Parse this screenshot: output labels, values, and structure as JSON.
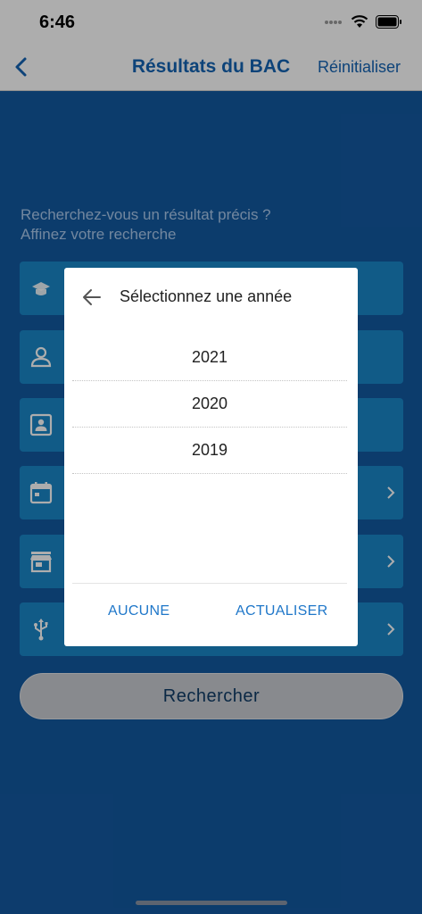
{
  "status": {
    "time": "6:46"
  },
  "nav": {
    "title": "Résultats du BAC",
    "reset_label": "Réinitialiser"
  },
  "form": {
    "intro_line1": "Recherchez-vous un résultat précis ?",
    "intro_line2": "Affinez votre recherche",
    "fields": [
      {
        "icon": "graduate-icon"
      },
      {
        "icon": "person-icon"
      },
      {
        "icon": "id-card-icon"
      },
      {
        "icon": "calendar-icon"
      },
      {
        "icon": "store-icon"
      },
      {
        "icon": "usb-icon"
      }
    ],
    "search_label": "Rechercher"
  },
  "dialog": {
    "title": "Sélectionnez une année",
    "years": [
      "2021",
      "2020",
      "2019"
    ],
    "none_label": "AUCUNE",
    "update_label": "ACTUALISER"
  },
  "colors": {
    "accent": "#1463b3",
    "background": "#1359a0",
    "field": "#1a86c8",
    "dialog_button": "#1f77c9"
  }
}
